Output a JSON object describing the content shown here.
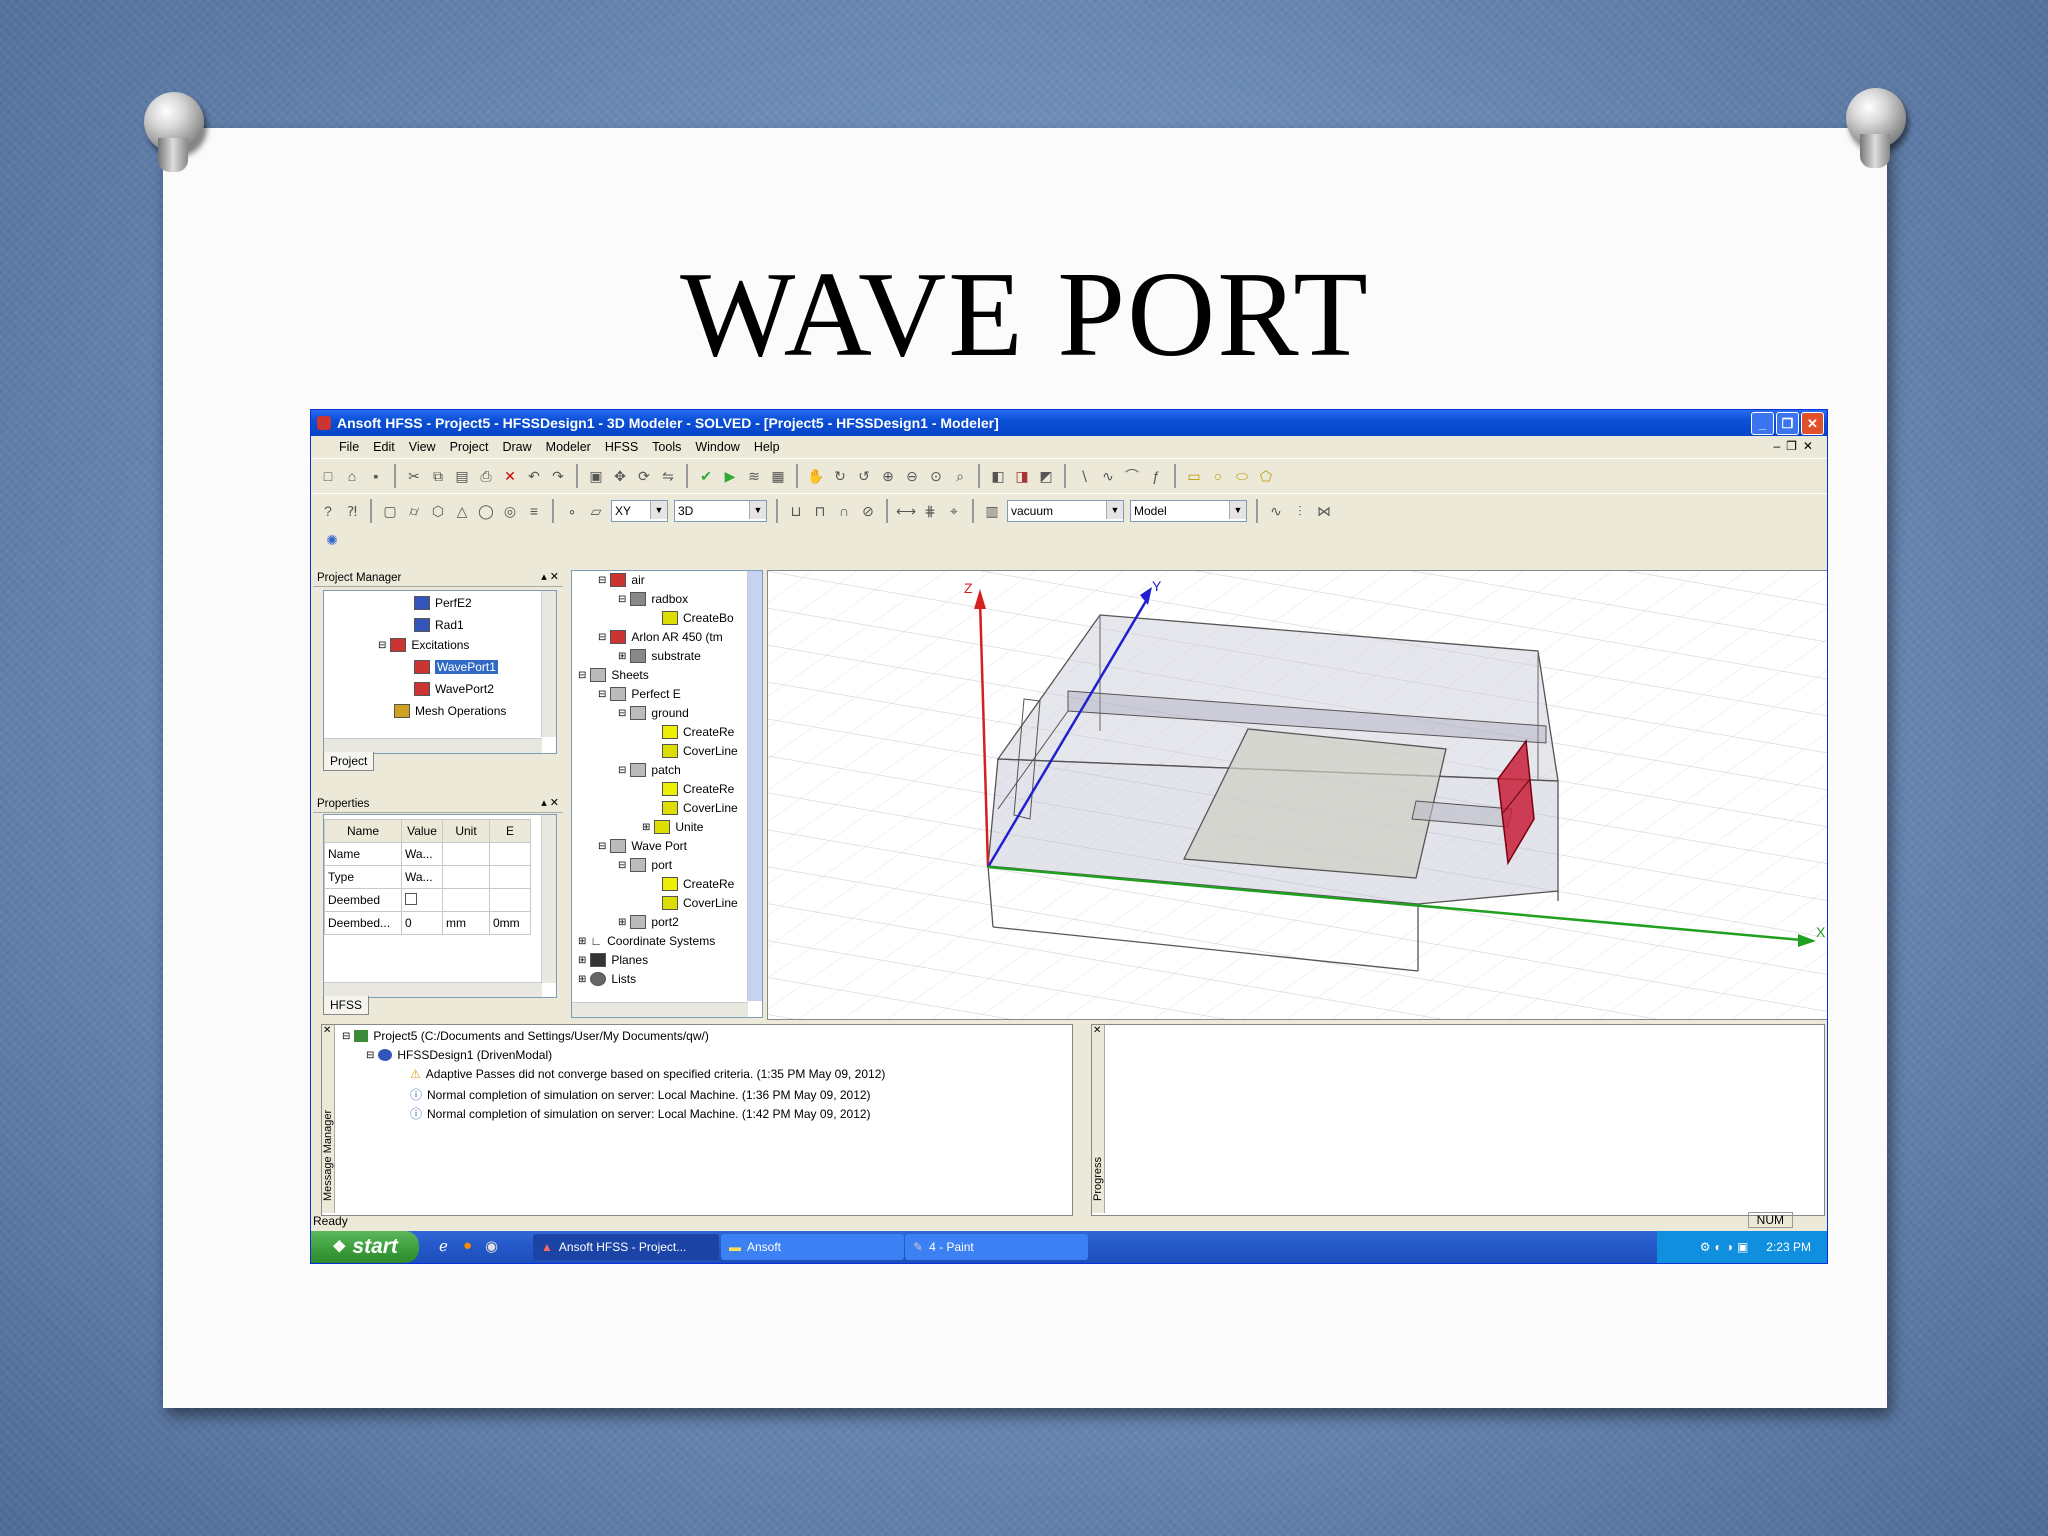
{
  "slide": {
    "title": "WAVE PORT"
  },
  "window": {
    "title": "Ansoft HFSS - Project5 - HFSSDesign1 - 3D Modeler - SOLVED - [Project5 - HFSSDesign1 - Modeler]",
    "menu": [
      "File",
      "Edit",
      "View",
      "Project",
      "Draw",
      "Modeler",
      "HFSS",
      "Tools",
      "Window",
      "Help"
    ],
    "toolbar": {
      "plane_value": "XY",
      "view_value": "3D",
      "material_value": "vacuum",
      "mode_value": "Model"
    }
  },
  "project_manager": {
    "header": "Project Manager",
    "items": [
      {
        "label": "PerfE2",
        "selected": false
      },
      {
        "label": "Rad1",
        "selected": false
      },
      {
        "label": "Excitations",
        "selected": false
      },
      {
        "label": "WavePort1",
        "selected": true
      },
      {
        "label": "WavePort2",
        "selected": false
      },
      {
        "label": "Mesh Operations",
        "selected": false
      }
    ],
    "tab": "Project"
  },
  "properties": {
    "header": "Properties",
    "columns": [
      "Name",
      "Value",
      "Unit",
      "E"
    ],
    "rows": [
      [
        "Name",
        "Wa...",
        "",
        ""
      ],
      [
        "Type",
        "Wa...",
        "",
        ""
      ],
      [
        "Deembed",
        "",
        "",
        ""
      ],
      [
        "Deembed...",
        "0",
        "mm",
        "0mm"
      ]
    ],
    "tab": "HFSS"
  },
  "model_tree": {
    "items": [
      "air",
      "radbox",
      "CreateBo",
      "Arlon AR 450 (tm",
      "substrate",
      "Sheets",
      "Perfect E",
      "ground",
      "CreateRe",
      "CoverLine",
      "patch",
      "CreateRe",
      "CoverLine",
      "Unite",
      "Wave Port",
      "port",
      "CreateRe",
      "CoverLine",
      "port2",
      "Coordinate Systems",
      "Planes",
      "Lists"
    ]
  },
  "viewport": {
    "axis_labels": [
      "Z",
      "Y",
      "X"
    ],
    "colors": {
      "z_axis": "#d42020",
      "y_axis": "#2020d0",
      "x_axis": "#20a020",
      "wave_port": "#c8203a"
    }
  },
  "message_manager": {
    "label": "Message Manager",
    "lines": [
      "Project5 (C:/Documents and Settings/User/My Documents/qw/)",
      "HFSSDesign1 (DrivenModal)",
      "Adaptive Passes did not converge based on specified criteria. (1:35 PM  May 09, 2012)",
      "Normal completion of simulation on server: Local Machine. (1:36 PM  May 09, 2012)",
      "Normal completion of simulation on server: Local Machine. (1:42 PM  May 09, 2012)"
    ]
  },
  "progress": {
    "label": "Progress"
  },
  "statusbar": {
    "text": "Ready",
    "num": "NUM"
  },
  "taskbar": {
    "start": "start",
    "tasks": [
      "Ansoft HFSS - Project...",
      "Ansoft",
      "4 - Paint"
    ],
    "clock": "2:23 PM"
  }
}
